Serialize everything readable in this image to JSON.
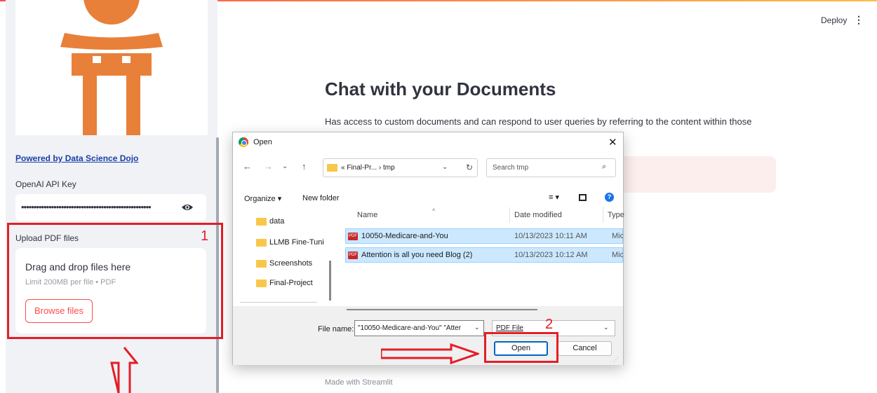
{
  "header": {
    "deploy_label": "Deploy",
    "menu_glyph": "⋮"
  },
  "sidebar": {
    "powered_by": "Powered by Data Science Dojo",
    "api_key_label": "OpenAI API Key",
    "api_key_value": "••••••••••••••••••••••••••••••••••••••••••••••••••••",
    "upload_label": "Upload PDF files",
    "dropzone_title": "Drag and drop files here",
    "dropzone_limit": "Limit 200MB per file • PDF",
    "browse_label": "Browse files",
    "logo_color": "#e8803a"
  },
  "main": {
    "title": "Chat with your Documents",
    "description": "Has access to custom documents and can respond to user queries by referring to the content within those",
    "footer": "Made with Streamlit"
  },
  "dialog": {
    "title": "Open",
    "close_glyph": "✕",
    "breadcrumb": "« Final-Pr...  ›  tmp",
    "search_placeholder": "Search tmp",
    "organize_label": "Organize ▾",
    "new_folder_label": "New folder",
    "view_glyph": "≡ ▾",
    "help_glyph": "?",
    "nav_items": [
      {
        "label": "data"
      },
      {
        "label": "LLMB Fine-Tuni"
      },
      {
        "label": "Screenshots"
      },
      {
        "label": "Final-Project"
      }
    ],
    "columns": {
      "name": "Name",
      "date": "Date modified",
      "type": "Type"
    },
    "files": [
      {
        "name": "10050-Medicare-and-You",
        "date": "10/13/2023 10:11 AM",
        "type": "Micro"
      },
      {
        "name": "Attention is all you need Blog (2)",
        "date": "10/13/2023 10:12 AM",
        "type": "Micro"
      }
    ],
    "file_name_label": "File name:",
    "file_name_value": "\"10050-Medicare-and-You\" \"Atter",
    "file_type_value": "PDF File",
    "open_label": "Open",
    "cancel_label": "Cancel"
  },
  "annotations": {
    "marker_1": "1",
    "marker_2": "2",
    "color": "#e41e26"
  }
}
